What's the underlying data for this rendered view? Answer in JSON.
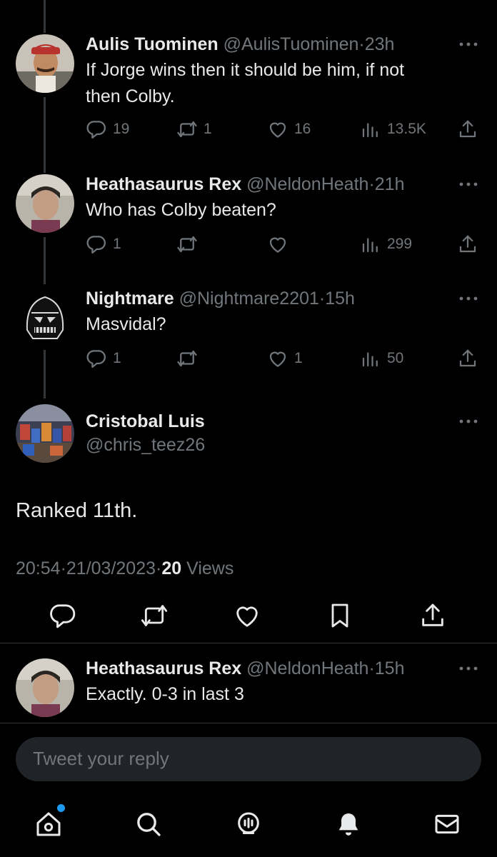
{
  "thread": [
    {
      "name": "Aulis Tuominen",
      "handle": "@AulisTuominen",
      "sep": "·",
      "time": "23h",
      "text_lines": [
        "If Jorge wins then it should be him, if not",
        "then Colby."
      ],
      "replies": "19",
      "retweets": "1",
      "likes": "16",
      "views": "13.5K"
    },
    {
      "name": "Heathasaurus Rex",
      "handle": "@NeldonHeath",
      "sep": "·",
      "time": "21h",
      "text_lines": [
        "Who has Colby beaten?"
      ],
      "replies": "1",
      "retweets": "",
      "likes": "",
      "views": "299"
    },
    {
      "name": "Nightmare",
      "handle": "@Nightmare2201",
      "sep": "·",
      "time": "15h",
      "text_lines": [
        "Masvidal?"
      ],
      "replies": "1",
      "retweets": "",
      "likes": "1",
      "views": "50"
    }
  ],
  "main_tweet": {
    "name": "Cristobal Luis",
    "handle": "@chris_teez26",
    "text": "Ranked 11th.",
    "time": "20:54",
    "sep1": "·",
    "date": "21/03/2023",
    "sep2": "·",
    "views_count": "20",
    "views_label": "Views"
  },
  "reply": {
    "name": "Heathasaurus Rex",
    "handle": "@NeldonHeath",
    "sep": "·",
    "time": "15h",
    "text": "Exactly. 0-3 in last 3"
  },
  "composer": {
    "placeholder": "Tweet your reply"
  },
  "nav": {
    "items": [
      "home-icon",
      "search-icon",
      "spaces-icon",
      "notifications-icon",
      "messages-icon"
    ],
    "notification_dot_color": "#1d9bf0"
  },
  "colors": {
    "background": "#000000",
    "text": "#e7e9ea",
    "muted": "#71767b",
    "thread_line": "#333639"
  }
}
